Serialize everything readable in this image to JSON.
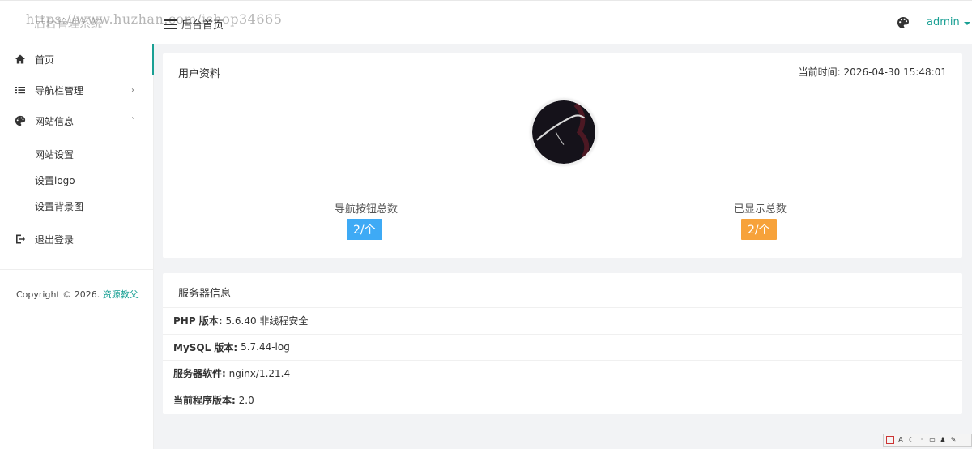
{
  "header": {
    "brand": "后台管理系统",
    "watermark": "https://www.huzhan.com/ishop34665",
    "menu_toggle_label": "后台首页",
    "user": "admin"
  },
  "sidebar": {
    "items": [
      {
        "label": "首页",
        "icon": "home-icon"
      },
      {
        "label": "导航栏管理",
        "icon": "list-icon",
        "arrow": "›"
      },
      {
        "label": "网站信息",
        "icon": "palette-icon",
        "arrow": "˅"
      },
      {
        "label": "退出登录",
        "icon": "logout-icon"
      }
    ],
    "sub_items": [
      "网站设置",
      "设置logo",
      "设置背景图"
    ],
    "copyright_prefix": "Copyright © 2026.",
    "copyright_link": "资源教父"
  },
  "profile_card": {
    "title": "用户资料",
    "time_label": "当前时间:",
    "time_value": "2026-04-30 15:48:01",
    "stats": [
      {
        "label": "导航按钮总数",
        "value": "2/个",
        "color": "#3eaaf5"
      },
      {
        "label": "已显示总数",
        "value": "2/个",
        "color": "#f7a23a"
      }
    ]
  },
  "server_card": {
    "title": "服务器信息",
    "rows": [
      {
        "key": "PHP 版本:",
        "value": "5.6.40 非线程安全"
      },
      {
        "key": "MySQL 版本:",
        "value": "5.7.44-log"
      },
      {
        "key": "服务器软件:",
        "value": "nginx/1.21.4"
      },
      {
        "key": "当前程序版本:",
        "value": "2.0"
      }
    ]
  },
  "colors": {
    "accent": "#1aa094",
    "blue_badge": "#3eaaf5",
    "orange_badge": "#f7a23a"
  }
}
